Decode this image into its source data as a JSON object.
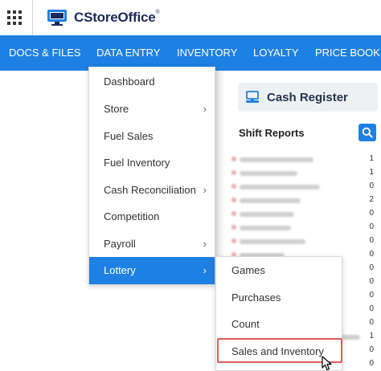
{
  "header": {
    "brand": "CStoreOffice",
    "brand_mark": "®",
    "apps_icon": "grid-icon",
    "logo_icon": "monitor-logo-icon"
  },
  "nav": {
    "items": [
      {
        "label": "DOCS & FILES"
      },
      {
        "label": "DATA ENTRY"
      },
      {
        "label": "INVENTORY"
      },
      {
        "label": "LOYALTY"
      },
      {
        "label": "PRICE BOOK"
      }
    ]
  },
  "data_entry_menu": {
    "items": [
      {
        "label": "Dashboard",
        "has_submenu": false
      },
      {
        "label": "Store",
        "has_submenu": true
      },
      {
        "label": "Fuel Sales",
        "has_submenu": false
      },
      {
        "label": "Fuel Inventory",
        "has_submenu": false
      },
      {
        "label": "Cash Reconciliation",
        "has_submenu": true
      },
      {
        "label": "Competition",
        "has_submenu": false
      },
      {
        "label": "Payroll",
        "has_submenu": true
      },
      {
        "label": "Lottery",
        "has_submenu": true,
        "active": true
      }
    ],
    "chevron": "›"
  },
  "lottery_submenu": {
    "items": [
      {
        "label": "Games"
      },
      {
        "label": "Purchases"
      },
      {
        "label": "Count"
      },
      {
        "label": "Sales and Inventory",
        "highlighted": true
      }
    ]
  },
  "cash_register": {
    "title": "Cash Register",
    "icon": "cash-register-icon",
    "shift_reports_title": "Shift Reports",
    "search_icon": "search-icon",
    "counts": [
      "1",
      "1",
      "0",
      "2",
      "0",
      "0",
      "0",
      "0",
      "0",
      "0",
      "0",
      "0",
      "0",
      "1",
      "0",
      "0"
    ]
  },
  "colors": {
    "nav_bg": "#1e80e2",
    "active_item": "#1e80e2",
    "highlight_border": "#e05c5c",
    "brand_text": "#1b2a5c"
  }
}
